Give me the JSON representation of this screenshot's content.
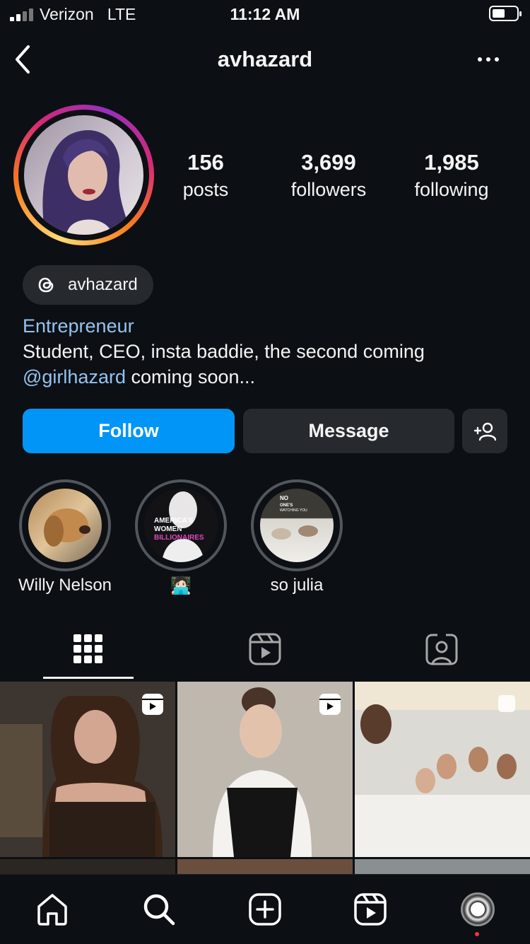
{
  "status_bar": {
    "carrier": "Verizon",
    "network": "LTE",
    "time": "11:12 AM"
  },
  "header": {
    "username": "avhazard",
    "back_icon": "chevron-left-icon",
    "more_icon": "ellipsis-icon"
  },
  "stats": [
    {
      "value": "156",
      "label": "posts"
    },
    {
      "value": "3,699",
      "label": "followers"
    },
    {
      "value": "1,985",
      "label": "following"
    }
  ],
  "threads": {
    "handle": "avhazard",
    "icon": "threads-icon"
  },
  "bio": {
    "category": "Entrepreneur",
    "line1": "Student, CEO, insta baddie, the second coming",
    "mention": "@girlhazard",
    "line2_rest": " coming soon..."
  },
  "actions": {
    "follow": "Follow",
    "message": "Message",
    "add_person_icon": "add-person-icon"
  },
  "highlights": [
    {
      "label": "Willy Nelson"
    },
    {
      "label": "🧑🏻‍💻",
      "image_text": [
        "AMERICA'S",
        "WOMEN",
        "BILLIONAIRES"
      ]
    },
    {
      "label": "so julia",
      "image_text": [
        "NO",
        "ONE'S",
        "WATCHING YOU"
      ]
    }
  ],
  "tabs": [
    {
      "name": "grid",
      "icon": "grid-icon",
      "active": true
    },
    {
      "name": "reels",
      "icon": "reels-icon",
      "active": false
    },
    {
      "name": "tagged",
      "icon": "tagged-icon",
      "active": false
    }
  ],
  "nav": [
    "home-icon",
    "search-icon",
    "create-icon",
    "reels-icon",
    "profile-avatar"
  ],
  "colors": {
    "background": "#0c1014",
    "link": "#94c3f0",
    "follow": "#0095f6",
    "button_dark": "#262a2f",
    "notification": "#ff3040"
  }
}
